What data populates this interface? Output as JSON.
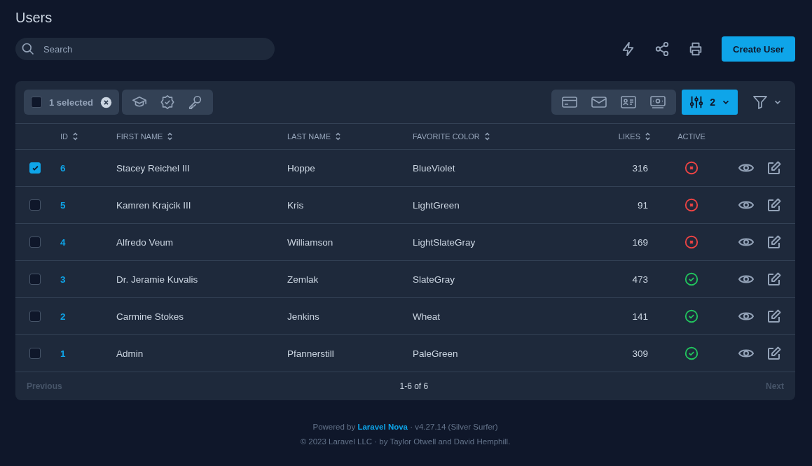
{
  "title": "Users",
  "search": {
    "placeholder": "Search"
  },
  "create_button": "Create User",
  "selection": {
    "checked": false,
    "label": "1 selected"
  },
  "filter_badge": "2",
  "columns": [
    {
      "label": "ID",
      "sortable": true
    },
    {
      "label": "FIRST NAME",
      "sortable": true
    },
    {
      "label": "LAST NAME",
      "sortable": true
    },
    {
      "label": "FAVORITE COLOR",
      "sortable": true
    },
    {
      "label": "LIKES",
      "sortable": true
    },
    {
      "label": "ACTIVE",
      "sortable": false
    }
  ],
  "rows": [
    {
      "selected": true,
      "id": "6",
      "first": "Stacey Reichel III",
      "last": "Hoppe",
      "favorite_color": "BlueViolet",
      "likes": "316",
      "active": false
    },
    {
      "selected": false,
      "id": "5",
      "first": "Kamren Krajcik III",
      "last": "Kris",
      "favorite_color": "LightGreen",
      "likes": "91",
      "active": false
    },
    {
      "selected": false,
      "id": "4",
      "first": "Alfredo Veum",
      "last": "Williamson",
      "favorite_color": "LightSlateGray",
      "likes": "169",
      "active": false
    },
    {
      "selected": false,
      "id": "3",
      "first": "Dr. Jeramie Kuvalis",
      "last": "Zemlak",
      "favorite_color": "SlateGray",
      "likes": "473",
      "active": true
    },
    {
      "selected": false,
      "id": "2",
      "first": "Carmine Stokes",
      "last": "Jenkins",
      "favorite_color": "Wheat",
      "likes": "141",
      "active": true
    },
    {
      "selected": false,
      "id": "1",
      "first": "Admin",
      "last": "Pfannerstill",
      "favorite_color": "PaleGreen",
      "likes": "309",
      "active": true
    }
  ],
  "pagination": {
    "previous": {
      "label": "Previous",
      "disabled": true
    },
    "status": "1-6 of 6",
    "next": {
      "label": "Next",
      "disabled": true
    }
  },
  "footer": {
    "powered_prefix": "Powered by",
    "link": "Laravel Nova",
    "version": "· v4.27.14 (Silver Surfer)",
    "copyright": "© 2023 Laravel LLC · by Taylor Otwell and David Hemphill."
  }
}
